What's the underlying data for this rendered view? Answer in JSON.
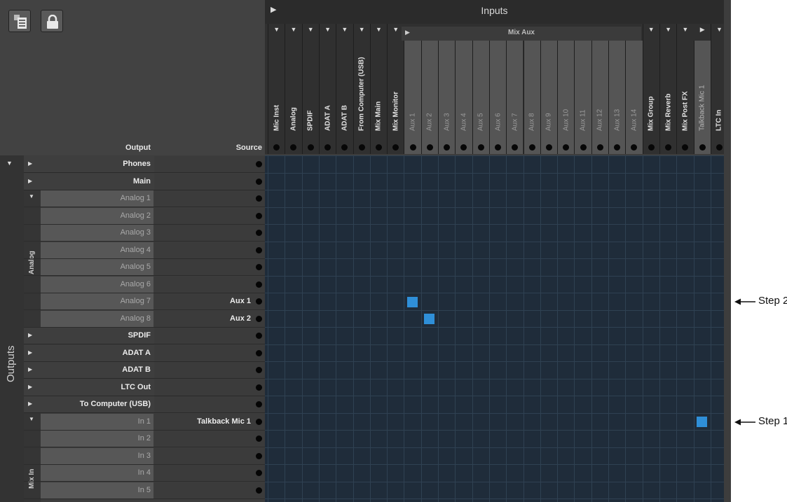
{
  "inputs_title": "Inputs",
  "mix_aux_title": "Mix Aux",
  "toolbar": {
    "icons": [
      "window-list-icon",
      "lock-icon"
    ]
  },
  "columns": [
    {
      "label": "Mic Inst",
      "type": "input"
    },
    {
      "label": "Analog",
      "type": "input"
    },
    {
      "label": "SPDIF",
      "type": "input"
    },
    {
      "label": "ADAT A",
      "type": "input"
    },
    {
      "label": "ADAT B",
      "type": "input"
    },
    {
      "label": "From Computer (USB)",
      "type": "input"
    },
    {
      "label": "Mix Main",
      "type": "input"
    },
    {
      "label": "Mix Monitor",
      "type": "input"
    },
    {
      "label": "Aux 1",
      "type": "aux"
    },
    {
      "label": "Aux 2",
      "type": "aux"
    },
    {
      "label": "Aux 3",
      "type": "aux"
    },
    {
      "label": "Aux 4",
      "type": "aux"
    },
    {
      "label": "Aux 5",
      "type": "aux"
    },
    {
      "label": "Aux 6",
      "type": "aux"
    },
    {
      "label": "Aux 7",
      "type": "aux"
    },
    {
      "label": "Aux 8",
      "type": "aux"
    },
    {
      "label": "Aux 9",
      "type": "aux"
    },
    {
      "label": "Aux 10",
      "type": "aux"
    },
    {
      "label": "Aux 11",
      "type": "aux"
    },
    {
      "label": "Aux 12",
      "type": "aux"
    },
    {
      "label": "Aux 13",
      "type": "aux"
    },
    {
      "label": "Aux 14",
      "type": "aux"
    },
    {
      "label": "Mix Group",
      "type": "input"
    },
    {
      "label": "Mix Reverb",
      "type": "input"
    },
    {
      "label": "Mix Post FX",
      "type": "input"
    },
    {
      "label": "Talkback Mic 1",
      "type": "talkback"
    },
    {
      "label": "LTC In",
      "type": "input"
    }
  ],
  "output_header": "Output",
  "source_header": "Source",
  "outputs_label": "Outputs",
  "groups": {
    "analog": "Analog",
    "mix_in": "Mix In"
  },
  "rows": [
    {
      "name": "Phones",
      "kind": "top",
      "source": ""
    },
    {
      "name": "Main",
      "kind": "top",
      "source": ""
    },
    {
      "name": "Analog 1",
      "kind": "sub",
      "source": ""
    },
    {
      "name": "Analog 2",
      "kind": "sub",
      "source": ""
    },
    {
      "name": "Analog 3",
      "kind": "sub",
      "source": ""
    },
    {
      "name": "Analog 4",
      "kind": "sub",
      "source": ""
    },
    {
      "name": "Analog 5",
      "kind": "sub",
      "source": ""
    },
    {
      "name": "Analog 6",
      "kind": "sub",
      "source": ""
    },
    {
      "name": "Analog 7",
      "kind": "sub",
      "source": "Aux 1"
    },
    {
      "name": "Analog 8",
      "kind": "sub",
      "source": "Aux 2"
    },
    {
      "name": "SPDIF",
      "kind": "top",
      "source": ""
    },
    {
      "name": "ADAT A",
      "kind": "top",
      "source": ""
    },
    {
      "name": "ADAT B",
      "kind": "top",
      "source": ""
    },
    {
      "name": "LTC Out",
      "kind": "top",
      "source": ""
    },
    {
      "name": "To Computer (USB)",
      "kind": "top",
      "source": ""
    },
    {
      "name": "In 1",
      "kind": "sub",
      "source": "Talkback Mic 1"
    },
    {
      "name": "In 2",
      "kind": "sub",
      "source": ""
    },
    {
      "name": "In 3",
      "kind": "sub",
      "source": ""
    },
    {
      "name": "In 4",
      "kind": "sub",
      "source": ""
    },
    {
      "name": "In 5",
      "kind": "sub",
      "source": ""
    }
  ],
  "routes": [
    {
      "output": "Analog 7",
      "input": "Aux 1"
    },
    {
      "output": "Analog 8",
      "input": "Aux 2"
    },
    {
      "output": "In 1",
      "input": "Talkback Mic 1"
    }
  ],
  "steps": [
    {
      "label": "Step 2",
      "row": "Analog 7"
    },
    {
      "label": "Step 1",
      "row": "In 1"
    }
  ],
  "colors": {
    "route": "#2f8fd8",
    "grid_bg": "#1f2c3a",
    "grid_line": "#2f4152"
  }
}
